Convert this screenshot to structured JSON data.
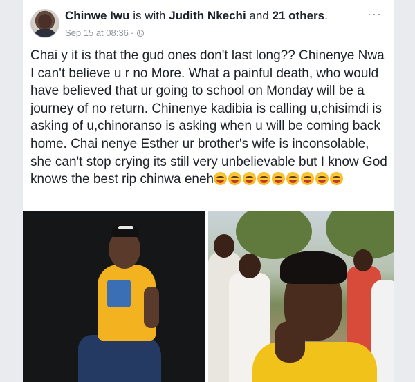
{
  "post": {
    "author": "Chinwe Iwu",
    "with_text": "is with",
    "tagged_friend": "Judith Nkechi",
    "and_text": "and",
    "others_link": "21 others",
    "period": ".",
    "timestamp": "Sep 15 at 08:36",
    "separator": "·",
    "privacy_icon": "globe-icon",
    "more_icon": "more-options-icon",
    "more_glyph": "···",
    "body": "Chai y it is that the gud ones don't last long?? Chinenye Nwa I can't believe u r no More. What a painful death, who would have believed that ur going to school on Monday will be a journey of no return. Chinenye kadibia is calling u,chisimdi is asking of u,chinoranso is asking when u will be coming back home. Chai nenye Esther ur brother's wife is inconsolable, she can't stop crying its still very unbelievable but I know God knows the best rip chinwa eneh",
    "emoji_count": 9,
    "emoji_icon": "crying-face-emoji"
  },
  "photos": [
    {
      "icon": "photo-woman-yellow-shirt"
    },
    {
      "icon": "photo-girl-in-crowd"
    }
  ],
  "colors": {
    "background": "#e9ebee",
    "card": "#ffffff",
    "text": "#1d2129",
    "meta": "#90949c"
  }
}
